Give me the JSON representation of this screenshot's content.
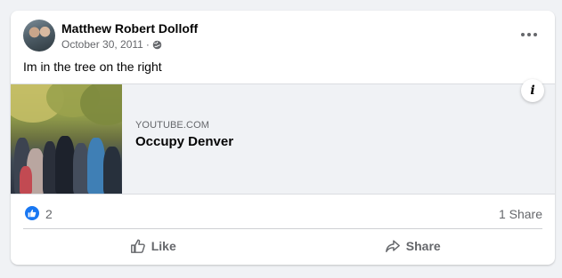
{
  "post": {
    "author": "Matthew Robert Dolloff",
    "date": "October 30, 2011",
    "separator": "·",
    "privacy_icon": "globe-icon",
    "text": "Im in the tree on the right"
  },
  "link_preview": {
    "domain": "YOUTUBE.COM",
    "title": "Occupy Denver",
    "info_label": "i"
  },
  "reactions": {
    "like_count": "2",
    "share_count": "1 Share"
  },
  "actions": {
    "like_label": "Like",
    "share_label": "Share"
  },
  "colors": {
    "accent": "#1877f2",
    "secondary_text": "#65676b",
    "background": "#f0f2f5"
  }
}
